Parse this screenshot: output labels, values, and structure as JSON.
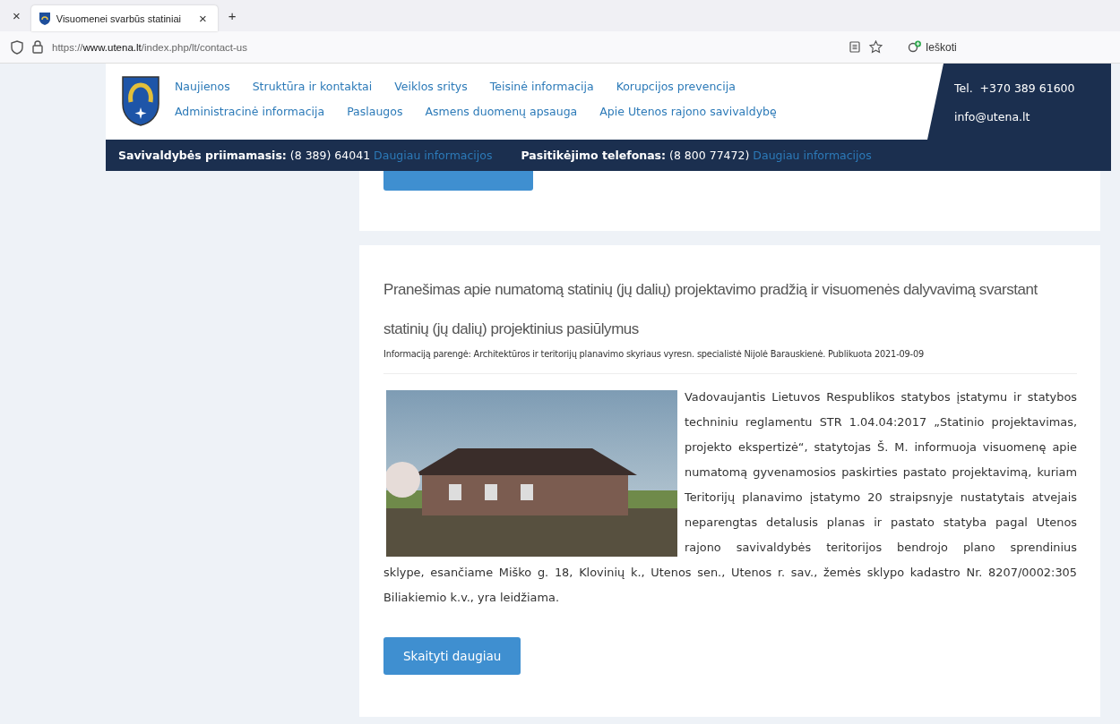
{
  "browser": {
    "tab": {
      "close": "×",
      "title": "Visuomenei svarbūs statiniai",
      "close_tab": "×",
      "new_tab": "+"
    },
    "address": {
      "scheme": "https://",
      "host": "www.utena.lt",
      "path": "/index.php/lt/contact-us"
    },
    "search": {
      "placeholder": "Ieškoti"
    }
  },
  "header": {
    "nav": [
      {
        "label": "Naujienos"
      },
      {
        "label": "Struktūra ir kontaktai"
      },
      {
        "label": "Veiklos sritys"
      },
      {
        "label": "Teisinė informacija"
      },
      {
        "label": "Korupcijos prevencija"
      }
    ],
    "nav_row_2": [
      {
        "label": "Administracinė informacija"
      },
      {
        "label": "Paslaugos"
      },
      {
        "label": "Asmens duomenų apsauga"
      },
      {
        "label": "Apie Utenos rajono savivaldybę"
      }
    ],
    "phone": "Tel.  +370 389 61600",
    "email": "info@utena.lt",
    "info_bar": [
      {
        "label": "Savivaldybės priimamasis:",
        "value": "(8 389) 64041",
        "link": "Daugiau informacijos"
      },
      {
        "label": "Pasitikėjimo telefonas:",
        "value": "(8 800 77472)",
        "link": "Daugiau informacijos"
      }
    ]
  },
  "cards": [
    {
      "kind": "partial"
    },
    {
      "kind": "article",
      "title": "Pranešimas apie numatomą statinių (jų dalių) projektavimo pradžią ir visuomenės dalyvavimą svarstant statinių (jų dalių) projektinius pasiūlymus",
      "meta": "Informaciją parengė: Architektūros ir teritorijų planavimo skyriaus vyresn. specialistė Nijolė Barauskienė. Publikuota 2021-09-09",
      "body": "Vadovaujantis Lietuvos Respublikos statybos įstatymu ir statybos techniniu reglamentu STR 1.04.04:2017 „Statinio projektavimas, projekto ekspertizė“, statytojas Š. M. informuoja visuomenę apie numatomą gyvenamosios paskirties pastato projektavimą, kuriam Teritorijų planavimo įstatymo 20 straipsnyje nustatytais atvejais neparengtas detalusis planas ir pastato statyba pagal Utenos rajono savivaldybės teritorijos bendrojo plano sprendinius",
      "body_continued": "sklype, esančiame Miško g. 18, Klovinių k., Utenos sen., Utenos r. sav., žemės sklypo kadastro Nr. 8207/0002:305 Biliakiemio k.v., yra leidžiama.",
      "button": "Skaityti daugiau"
    }
  ]
}
